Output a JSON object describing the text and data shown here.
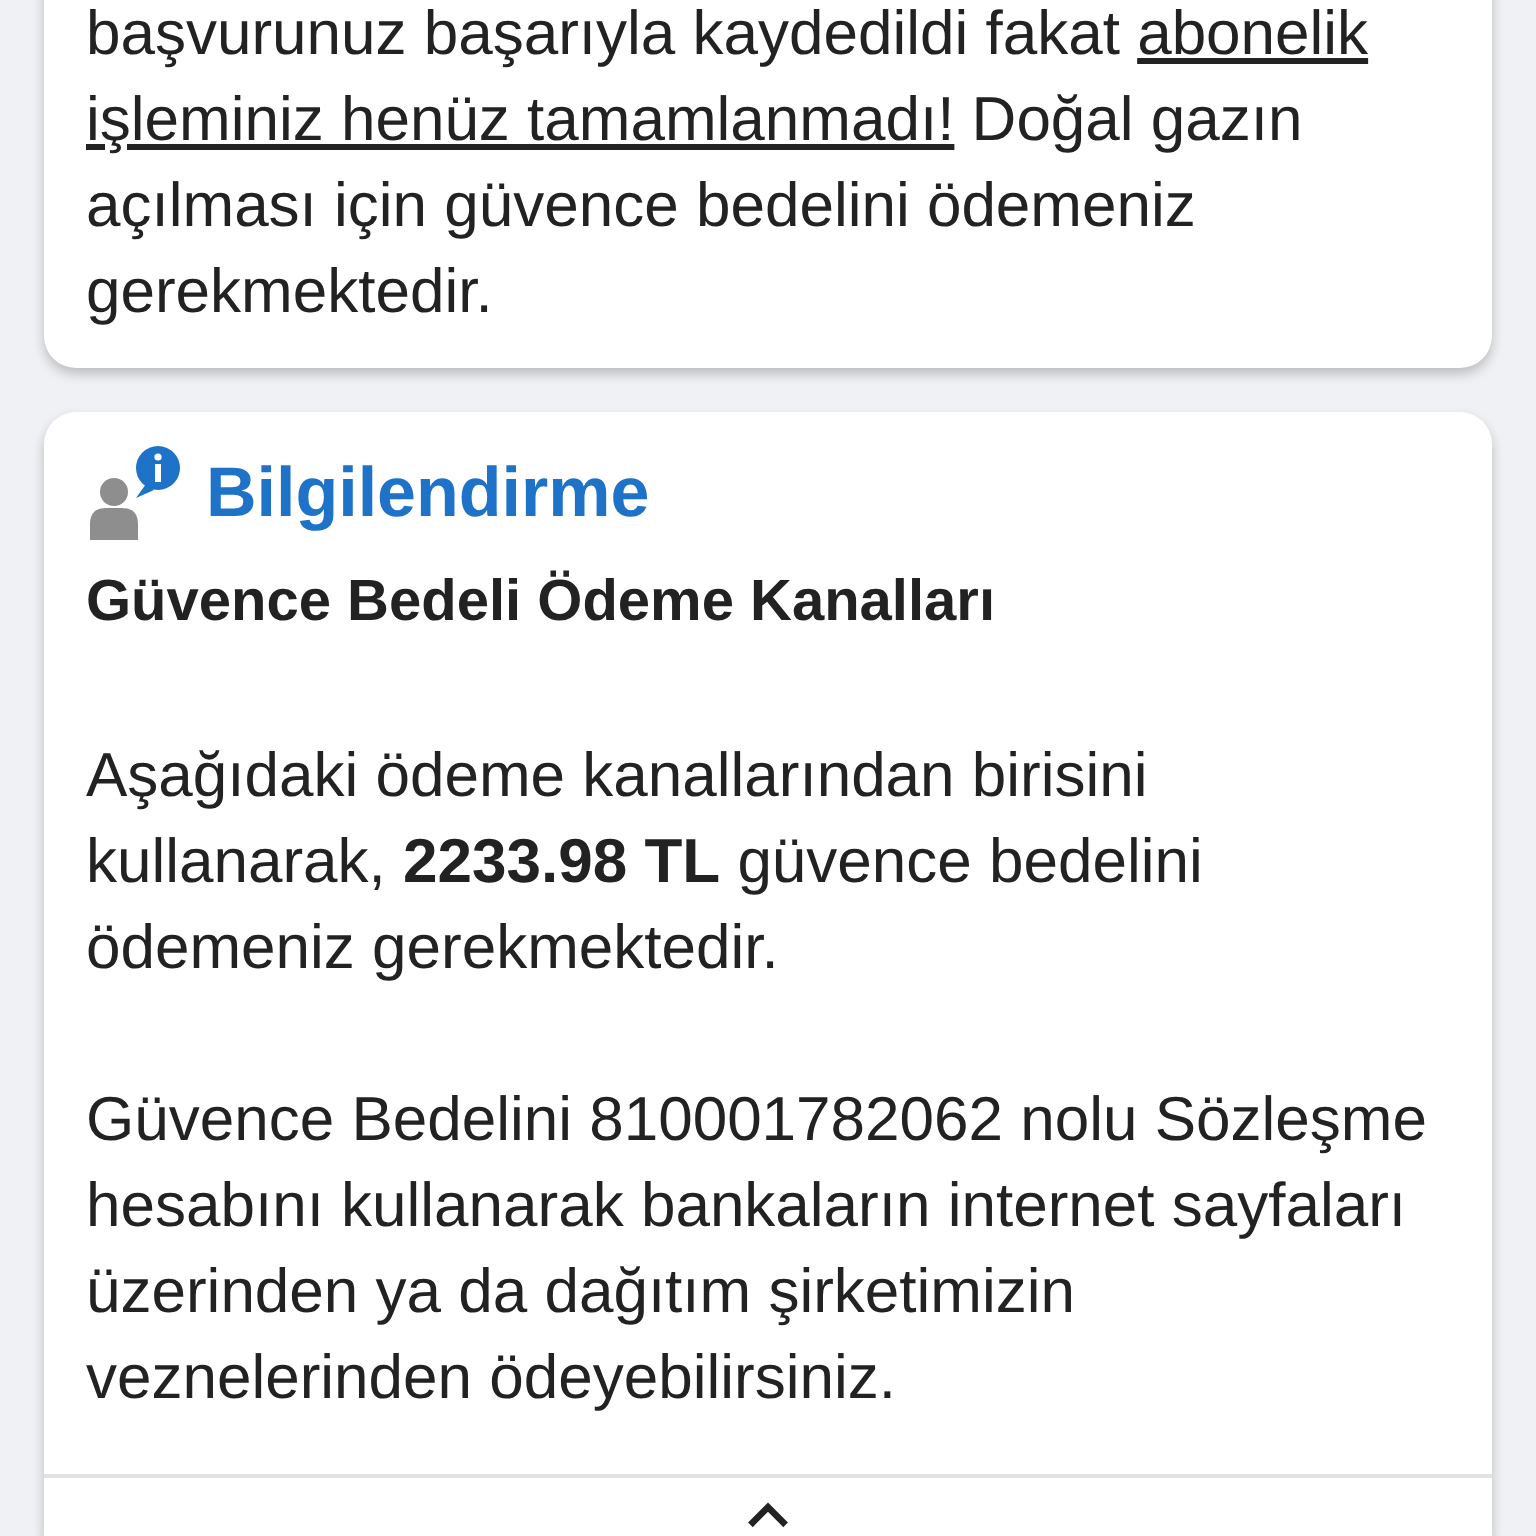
{
  "status_card": {
    "text_before": "başvurunuz başarıyla kaydedildi fakat ",
    "underlined": "abonelik işleminiz henüz tamamlanmadı!",
    "text_after": " Doğal gazın açılması için güvence bedelini ödemeniz gerekmektedir."
  },
  "info_card": {
    "title": "Bilgilendirme",
    "subtitle": "Güvence Bedeli Ödeme Kanalları",
    "paragraphs": [
      "Aşağıdaki ödeme kanallarından birisini kullanarak, **2233.98 TL** güvence bedelini ödemeniz gerekmektedir.",
      "Güvence Bedelini 810001782062 nolu Sözleşme hesabını kullanarak bankaların internet sayfaları üzerinden ya da dağıtım şirketimizin veznelerinden ödeyebilirsiniz."
    ]
  },
  "bottom_bar": {
    "expanded": false
  }
}
